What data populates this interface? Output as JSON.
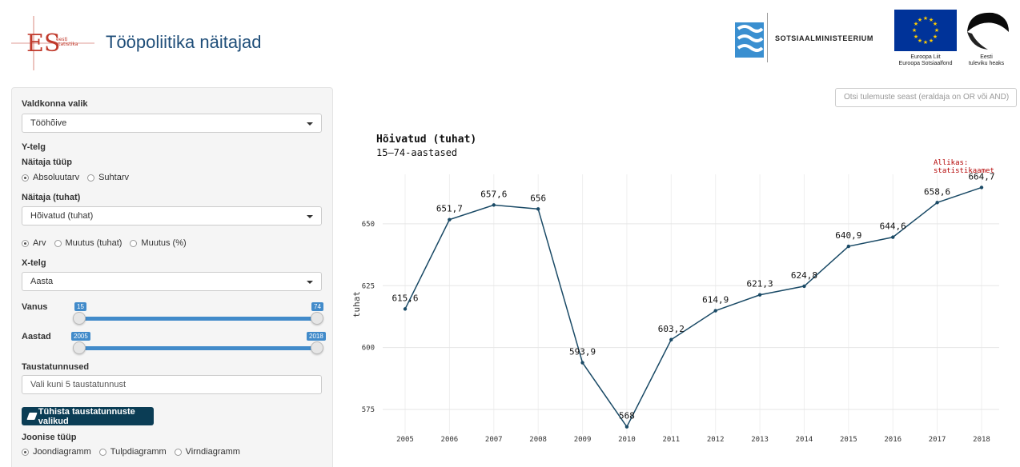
{
  "header": {
    "title": "Tööpoliitika näitajad",
    "logo_text": "eesti statistika",
    "ministry": "SOTSIAALMINISTEERIUM",
    "eu_caption_1": "Euroopa Liit",
    "eu_caption_2": "Euroopa Sotsiaalfond",
    "ee_caption_1": "Eesti",
    "ee_caption_2": "tuleviku heaks"
  },
  "sidebar": {
    "domain_label": "Valdkonna valik",
    "domain_value": "Tööhõive",
    "y_axis_label": "Y-telg",
    "indicator_type_label": "Näitaja tüüp",
    "indicator_types": [
      "Absoluutarv",
      "Suhtarv"
    ],
    "indicator_label": "Näitaja (tuhat)",
    "indicator_value": "Hõivatud (tuhat)",
    "measures": [
      "Arv",
      "Muutus (tuhat)",
      "Muutus (%)"
    ],
    "x_axis_label": "X-telg",
    "x_axis_value": "Aasta",
    "age_label": "Vanus",
    "age_min": "15",
    "age_max": "74",
    "years_label": "Aastad",
    "years_min": "2005",
    "years_max": "2018",
    "background_label": "Taustatunnused",
    "background_placeholder": "Vali kuni 5 taustatunnust",
    "clear_button": "Tühista taustatunnuste valikud",
    "chart_type_label": "Joonise tüüp",
    "chart_types": [
      "Joondiagramm",
      "Tulpdiagramm",
      "Virndiagramm"
    ]
  },
  "search": {
    "placeholder": "Otsi tulemuste seast (eraldaja on OR või AND)"
  },
  "chart_data": {
    "type": "line",
    "title": "Hõivatud (tuhat)",
    "subtitle": "15–74-aastased",
    "source": "Allikas: statistikaamet",
    "xlabel": "",
    "ylabel": "tuhat",
    "x": [
      "2005",
      "2006",
      "2007",
      "2008",
      "2009",
      "2010",
      "2011",
      "2012",
      "2013",
      "2014",
      "2015",
      "2016",
      "2017",
      "2018"
    ],
    "values": [
      615.6,
      651.7,
      657.6,
      656,
      593.9,
      568,
      603.2,
      614.9,
      621.3,
      624.8,
      640.9,
      644.6,
      658.6,
      664.7
    ],
    "labels": [
      "615,6",
      "651,7",
      "657,6",
      "656",
      "593,9",
      "568",
      "603,2",
      "614,9",
      "621,3",
      "624,8",
      "640,9",
      "644,6",
      "658,6",
      "664,7"
    ],
    "yticks": [
      575,
      600,
      625,
      650
    ],
    "ylim": [
      565,
      670
    ],
    "grid": true,
    "line_color": "#1a4a66"
  }
}
